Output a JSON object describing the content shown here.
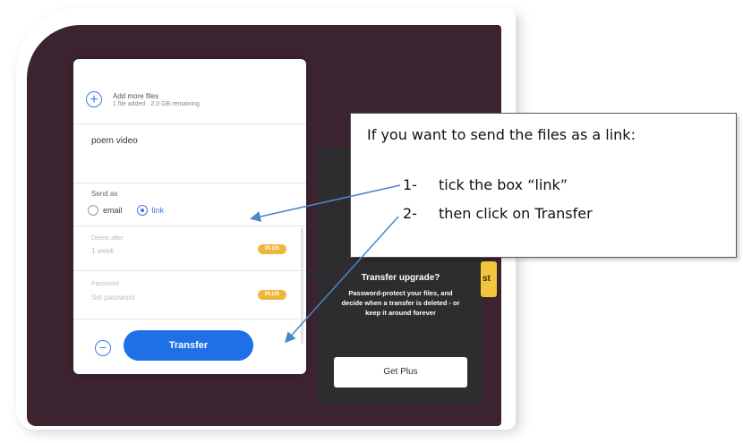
{
  "panel": {
    "add_more_title": "Add more files",
    "add_more_sub": "1 file added · 2.0 GB remaining",
    "message": "poem video",
    "send_as_label": "Send as",
    "option_email": "email",
    "option_link": "link",
    "selected_option": "link",
    "delete_after_label": "Delete after",
    "delete_after_value": "1 week",
    "password_label": "Password",
    "password_placeholder": "Set password",
    "plus_badge": "PLUS",
    "transfer_label": "Transfer"
  },
  "upsell": {
    "tab_letters": "st",
    "title": "Transfer upgrade?",
    "body": "Password-protect your files, and decide when a transfer is deleted - or keep it around forever",
    "get_plus_label": "Get Plus"
  },
  "callout": {
    "heading": "If you want to send the files as a link:",
    "steps": [
      {
        "num": "1-",
        "text": "tick the box “link”"
      },
      {
        "num": "2-",
        "text": "then click on Transfer"
      }
    ]
  },
  "colors": {
    "background": "#3b2330",
    "accent": "#1f6fe6",
    "plus_badge": "#f2b53b",
    "upsell_panel": "#2d2d2f",
    "arrow": "#4a86c8"
  },
  "icons": [
    "add-circle-icon",
    "radio-icon",
    "collapse-circle-icon"
  ]
}
